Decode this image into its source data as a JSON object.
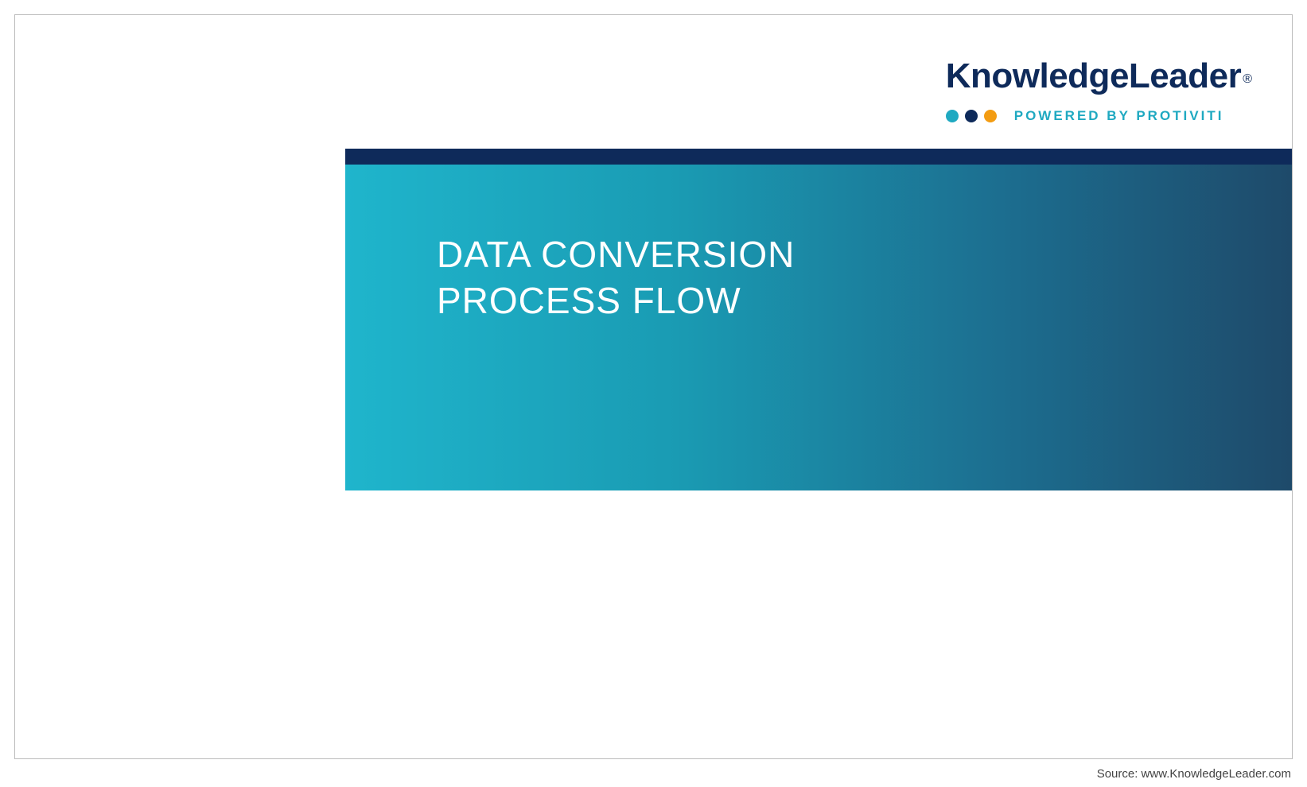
{
  "logo": {
    "brand": "KnowledgeLeader",
    "registered": "®",
    "tagline": "POWERED BY PROTIVITI"
  },
  "title": "DATA CONVERSION\nPROCESS FLOW",
  "source": "Source: www.KnowledgeLeader.com"
}
